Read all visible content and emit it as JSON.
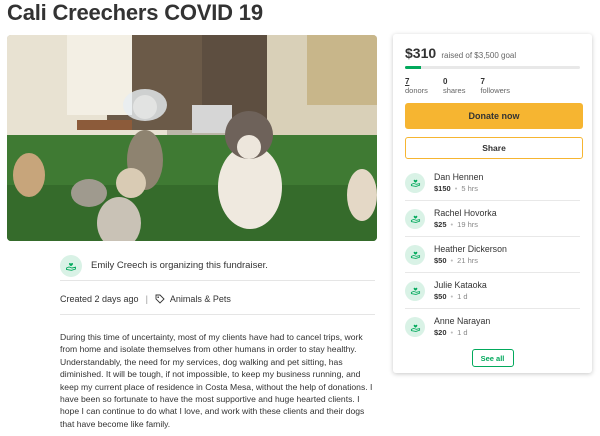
{
  "campaign": {
    "title": "Cali Creechers COVID 19"
  },
  "organizer": {
    "text": "Emily Creech is organizing this fundraiser."
  },
  "meta": {
    "created": "Created 2 days ago",
    "separator": "|",
    "category": "Animals & Pets"
  },
  "story": {
    "text": "During this time of uncertainty, most of my clients have had to cancel trips, work from home and isolate themselves from other humans in order to stay healthy. Understandably, the need for my services, dog walking and pet sitting, has diminished. It will be tough, if not impossible, to keep my business running, and keep my current place of residence in Costa Mesa, without the help of donations. I have been so fortunate to have the most supportive and huge hearted clients. I hope I can continue to do what I love, and work with these clients and their dogs that have become like family."
  },
  "card": {
    "raised_amount": "$310",
    "raised_text": "raised of $3,500 goal",
    "progress_fraction": 0.0886,
    "stats": [
      {
        "number": "7",
        "label": "donors"
      },
      {
        "number": "0",
        "label": "shares"
      },
      {
        "number": "7",
        "label": "followers"
      }
    ],
    "donate_label": "Donate now",
    "share_label": "Share",
    "see_all_label": "See all"
  },
  "donations": [
    {
      "name": "Dan Hennen",
      "amount": "$150",
      "time": "5 hrs"
    },
    {
      "name": "Rachel Hovorka",
      "amount": "$25",
      "time": "19 hrs"
    },
    {
      "name": "Heather Dickerson",
      "amount": "$50",
      "time": "21 hrs"
    },
    {
      "name": "Julie Kataoka",
      "amount": "$50",
      "time": "1 d"
    },
    {
      "name": "Anne Narayan",
      "amount": "$20",
      "time": "1 d"
    }
  ],
  "colors": {
    "brand_green": "#02a95c",
    "donate_yellow": "#f6b531",
    "avatar_bg": "#d9f2e6"
  },
  "icons": {
    "avatar": "heart-hand-icon",
    "category": "tag-icon"
  }
}
